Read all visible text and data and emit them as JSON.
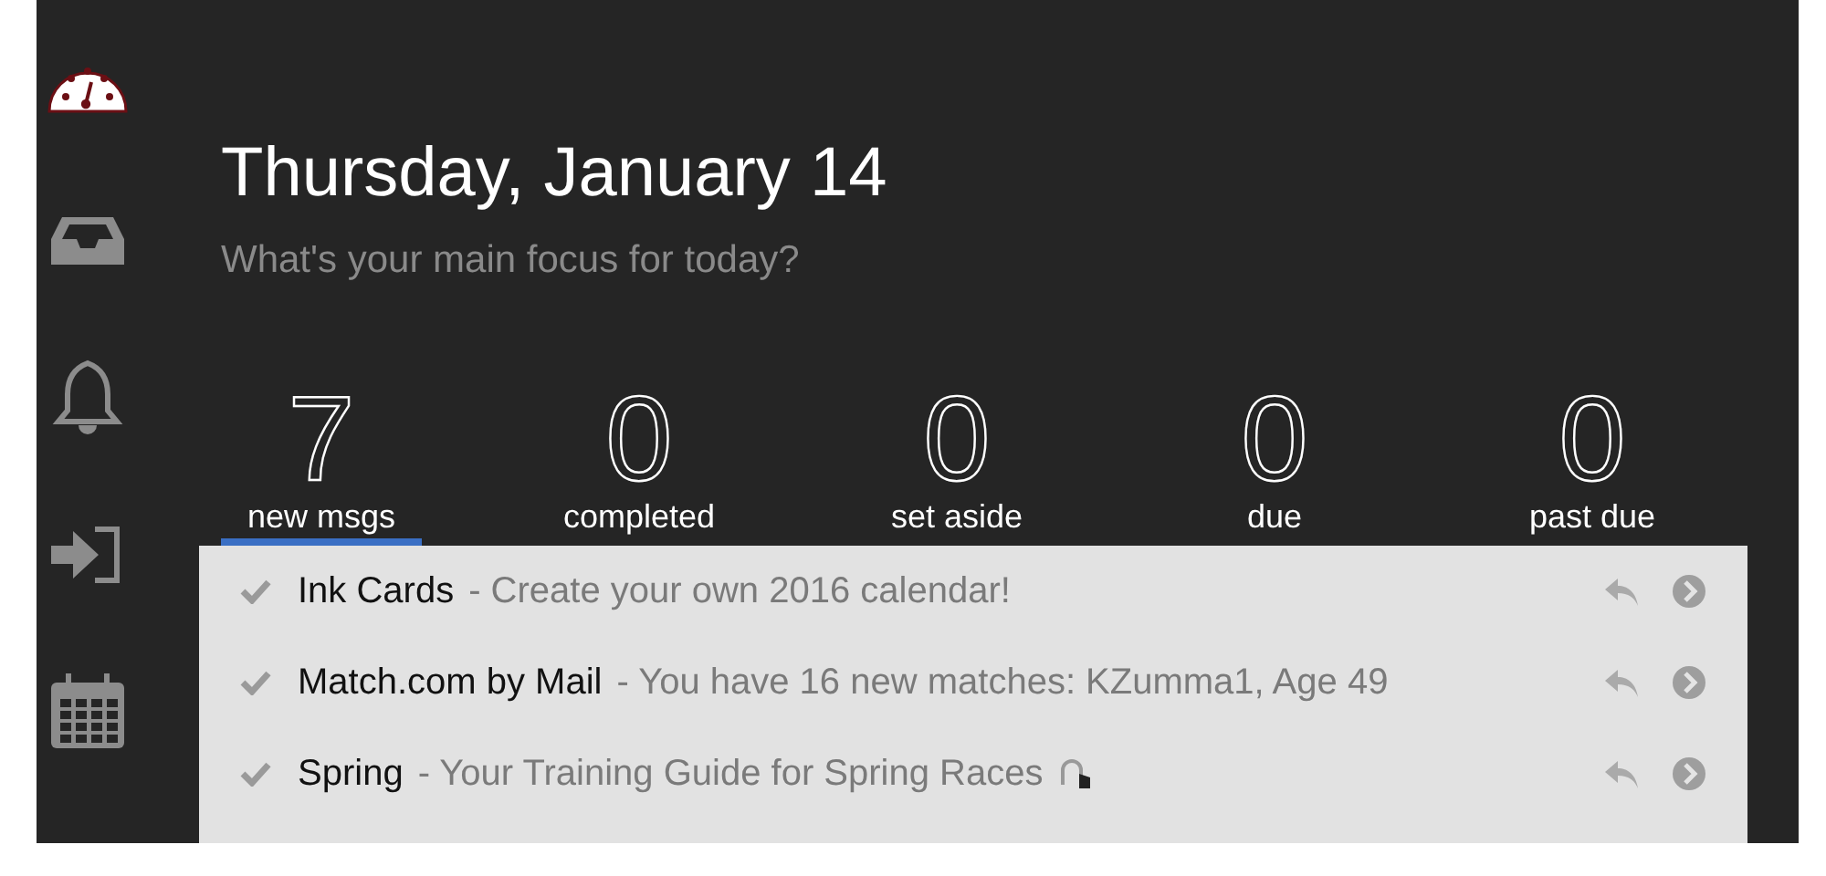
{
  "sidebar": {
    "items": [
      {
        "kind": "dashboard",
        "selected": true
      },
      {
        "kind": "inbox",
        "selected": false
      },
      {
        "kind": "bell",
        "selected": false
      },
      {
        "kind": "sign-in",
        "selected": false
      },
      {
        "kind": "calendar",
        "selected": false
      }
    ]
  },
  "header": {
    "date": "Thursday, January 14",
    "focus": {
      "placeholder": "What's your main focus for today?"
    }
  },
  "stats": [
    {
      "count": "7",
      "label": "new msgs",
      "selected": true
    },
    {
      "count": "0",
      "label": "completed",
      "selected": false
    },
    {
      "count": "0",
      "label": "set aside",
      "selected": false
    },
    {
      "count": "0",
      "label": "due",
      "selected": false
    },
    {
      "count": "0",
      "label": "past due",
      "selected": false
    }
  ],
  "messages": [
    {
      "sender": "Ink Cards",
      "subject": "- Create your own 2016 calendar!",
      "emoji": false
    },
    {
      "sender": "Match.com by Mail",
      "subject": "- You have 16 new matches: KZumma1, Age 49",
      "emoji": false
    },
    {
      "sender": "Spring",
      "subject": "- Your Training Guide for Spring Races",
      "emoji": true
    }
  ]
}
